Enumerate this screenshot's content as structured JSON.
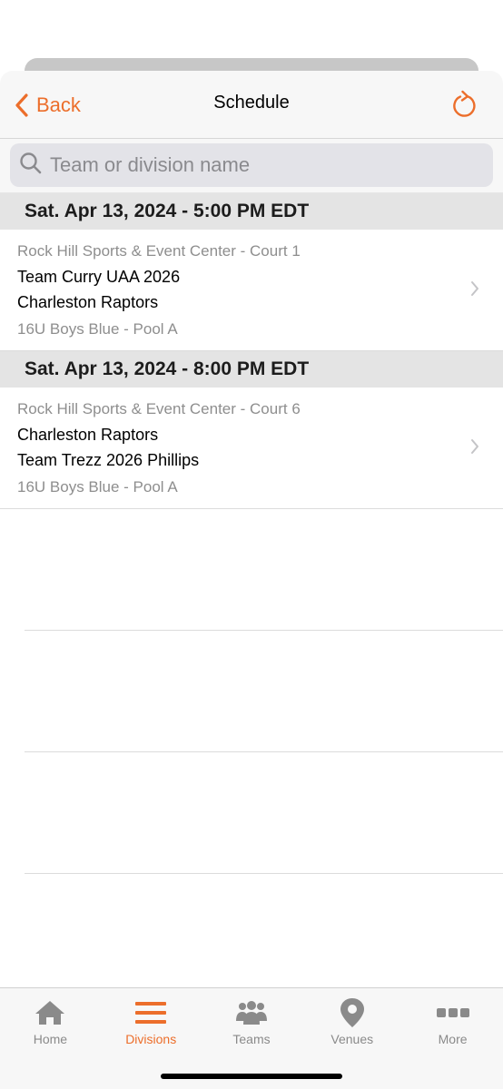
{
  "header": {
    "back_label": "Back",
    "title": "Schedule"
  },
  "search": {
    "placeholder": "Team or division name",
    "value": ""
  },
  "schedule": [
    {
      "datetime": "Sat. Apr 13, 2024 - 5:00 PM EDT",
      "venue": "Rock Hill Sports & Event Center - Court 1",
      "team1": "Team Curry UAA 2026",
      "team2": "Charleston Raptors",
      "division": "16U Boys Blue - Pool A"
    },
    {
      "datetime": "Sat. Apr 13, 2024 - 8:00 PM EDT",
      "venue": "Rock Hill Sports & Event Center - Court 6",
      "team1": "Charleston Raptors",
      "team2": "Team Trezz 2026 Phillips",
      "division": "16U Boys Blue - Pool A"
    }
  ],
  "tabbar": {
    "items": [
      {
        "label": "Home",
        "icon": "home-icon",
        "active": false
      },
      {
        "label": "Divisions",
        "icon": "list-icon",
        "active": true
      },
      {
        "label": "Teams",
        "icon": "people-icon",
        "active": false
      },
      {
        "label": "Venues",
        "icon": "map-pin-icon",
        "active": false
      },
      {
        "label": "More",
        "icon": "more-dots-icon",
        "active": false
      }
    ]
  },
  "colors": {
    "accent": "#ec6e2b",
    "inactive": "#8a8a8a",
    "section_bg": "#e4e4e4"
  }
}
